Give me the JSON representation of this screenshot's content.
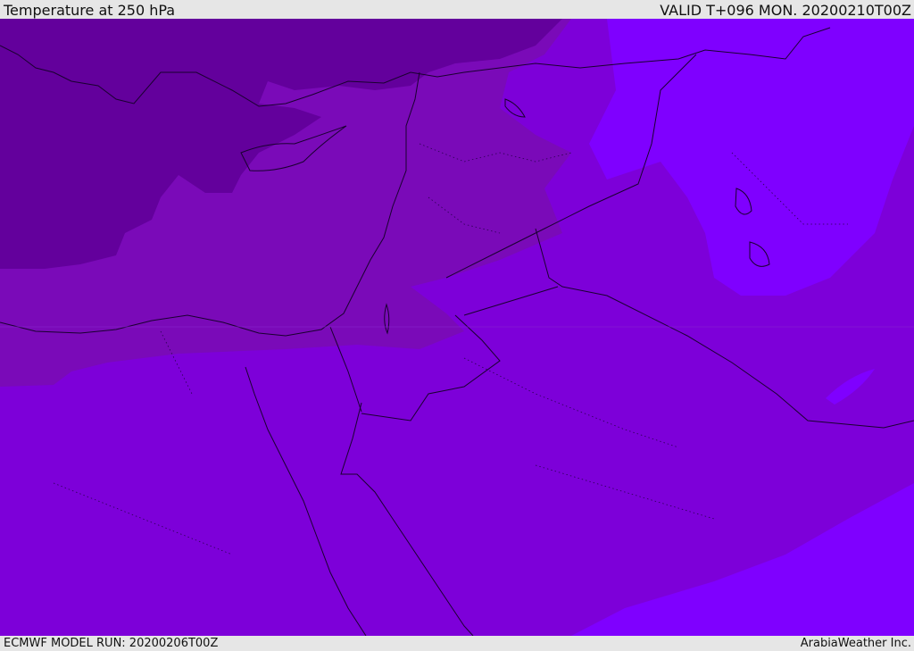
{
  "header": {
    "title": "Temperature at 250 hPa",
    "valid_time": "VALID T+096 MON. 20200210T00Z"
  },
  "footer": {
    "model_run": "ECMWF MODEL RUN: 20200206T00Z",
    "credit": "ArabiaWeather Inc."
  },
  "colors": {
    "bar_background": "#e6e6e6",
    "level_darkest": "#63009c",
    "level_dark": "#7a0ab8",
    "level_mid": "#7d00d9",
    "level_light": "#7f00ff",
    "coastline": "#1a0030"
  }
}
